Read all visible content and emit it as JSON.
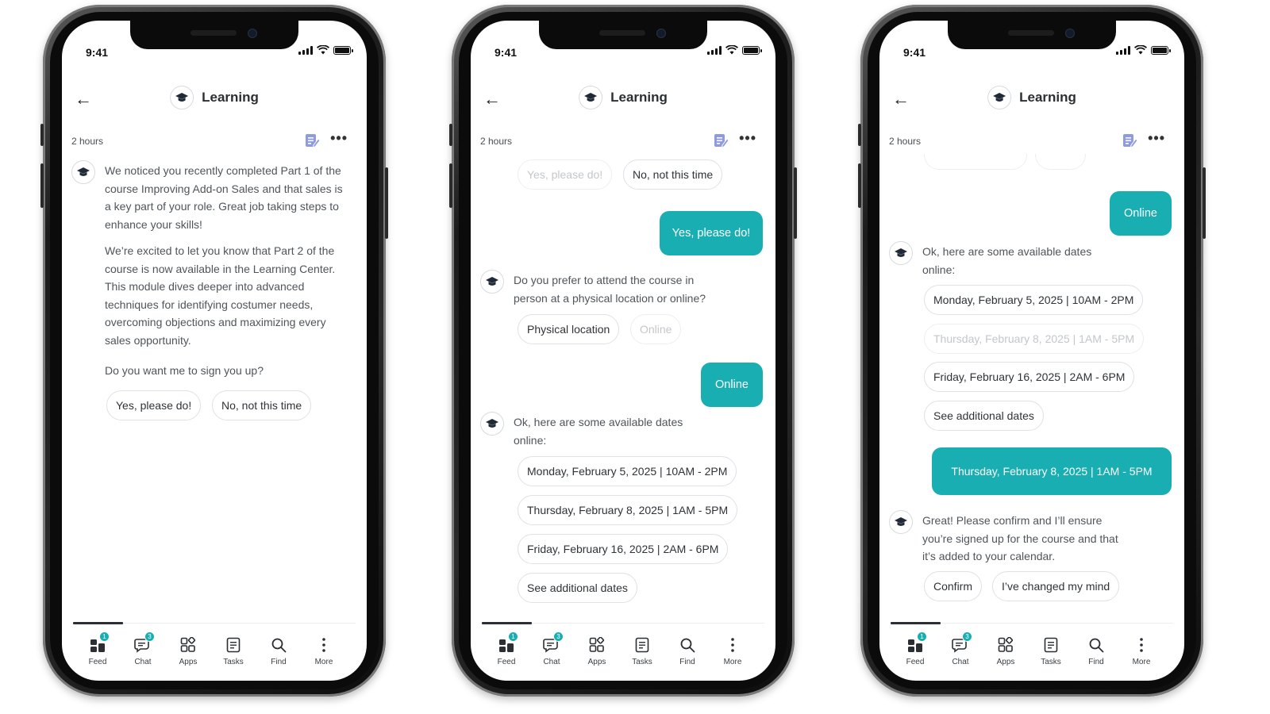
{
  "colors": {
    "accent": "#19aeb1",
    "text": "#2f3338",
    "muted_text": "#4f555b",
    "faded_text": "#c3c7cb"
  },
  "status": {
    "time": "9:41"
  },
  "header": {
    "title": "Learning",
    "back_icon": "arrow-left-icon",
    "avatar_icon": "graduation-cap-icon"
  },
  "meta": {
    "timestamp": "2 hours"
  },
  "tabs": [
    {
      "label": "Feed",
      "icon": "feed-icon",
      "badge": "1"
    },
    {
      "label": "Chat",
      "icon": "chat-icon",
      "badge": "3"
    },
    {
      "label": "Apps",
      "icon": "apps-icon",
      "badge": ""
    },
    {
      "label": "Tasks",
      "icon": "tasks-icon",
      "badge": ""
    },
    {
      "label": "Find",
      "icon": "search-icon",
      "badge": ""
    },
    {
      "label": "More",
      "icon": "more-vertical-icon",
      "badge": ""
    }
  ],
  "screens": {
    "one": {
      "intro_p1": "We noticed you recently completed Part 1 of the course Improving Add-on Sales and that sales is a key part of your role. Great job taking steps to enhance your skills!",
      "intro_p2": "We’re excited to let you know that Part 2 of the course is now available in the Learning Center. This module dives deeper into advanced techniques for identifying costumer needs, overcoming objections and maximizing every sales opportunity.",
      "question": "Do you want me to sign you up?",
      "options": [
        "Yes, please do!",
        "No, not this time"
      ]
    },
    "two": {
      "prev_options": [
        "Yes, please do!",
        "No, not this time"
      ],
      "reply_1": "Yes, please do!",
      "question": "Do you prefer to attend the course in person at a physical location or online?",
      "options": [
        "Physical location",
        "Online"
      ],
      "reply_2": "Online",
      "dates_msg": "Ok, here are some available dates online:",
      "dates": [
        "Monday, February 5, 2025 | 10AM - 2PM",
        "Thursday, February 8, 2025 | 1AM - 5PM",
        "Friday, February 16, 2025 | 2AM - 6PM",
        "See additional dates"
      ]
    },
    "three": {
      "reply_1": "Online",
      "dates_msg": "Ok, here are some available dates online:",
      "dates": [
        "Monday, February 5, 2025 | 10AM - 2PM",
        "Thursday, February 8, 2025 | 1AM - 5PM",
        "Friday, February 16, 2025 | 2AM - 6PM",
        "See additional dates"
      ],
      "reply_2": "Thursday, February 8, 2025 | 1AM - 5PM",
      "confirm_msg": "Great! Please confirm and I’ll ensure you’re signed up for the course and that it’s added to your calendar.",
      "options": [
        "Confirm",
        "I’ve changed my mind"
      ]
    }
  }
}
